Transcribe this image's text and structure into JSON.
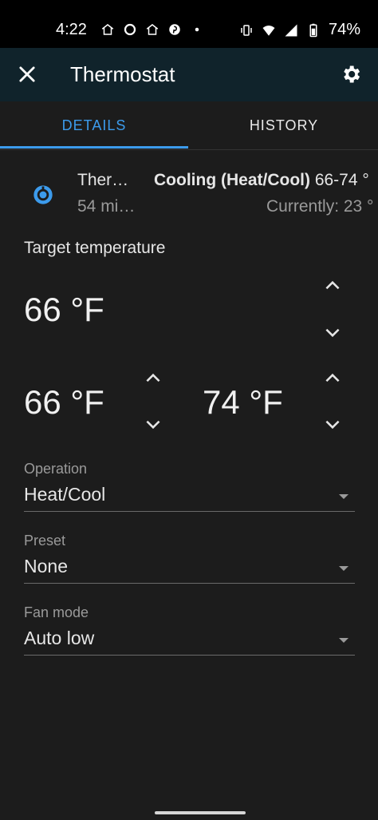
{
  "status_bar": {
    "time": "4:22",
    "battery": "74%"
  },
  "header": {
    "title": "Thermostat"
  },
  "tabs": [
    {
      "label": "DETAILS",
      "active": true
    },
    {
      "label": "HISTORY",
      "active": false
    }
  ],
  "entity": {
    "name": "Ther…",
    "last_changed": "54 mi…",
    "state_bold": "Cooling (Heat/Cool)",
    "state_range": "66-74 °",
    "current": "Currently: 23 °"
  },
  "target": {
    "label": "Target temperature",
    "single": "66 °F",
    "low": "66 °F",
    "high": "74 °F"
  },
  "operation": {
    "label": "Operation",
    "value": "Heat/Cool"
  },
  "preset": {
    "label": "Preset",
    "value": "None"
  },
  "fan_mode": {
    "label": "Fan mode",
    "value": "Auto low"
  },
  "colors": {
    "accent": "#3c9bec",
    "app_bar": "#10232b",
    "background": "#1c1c1c"
  }
}
